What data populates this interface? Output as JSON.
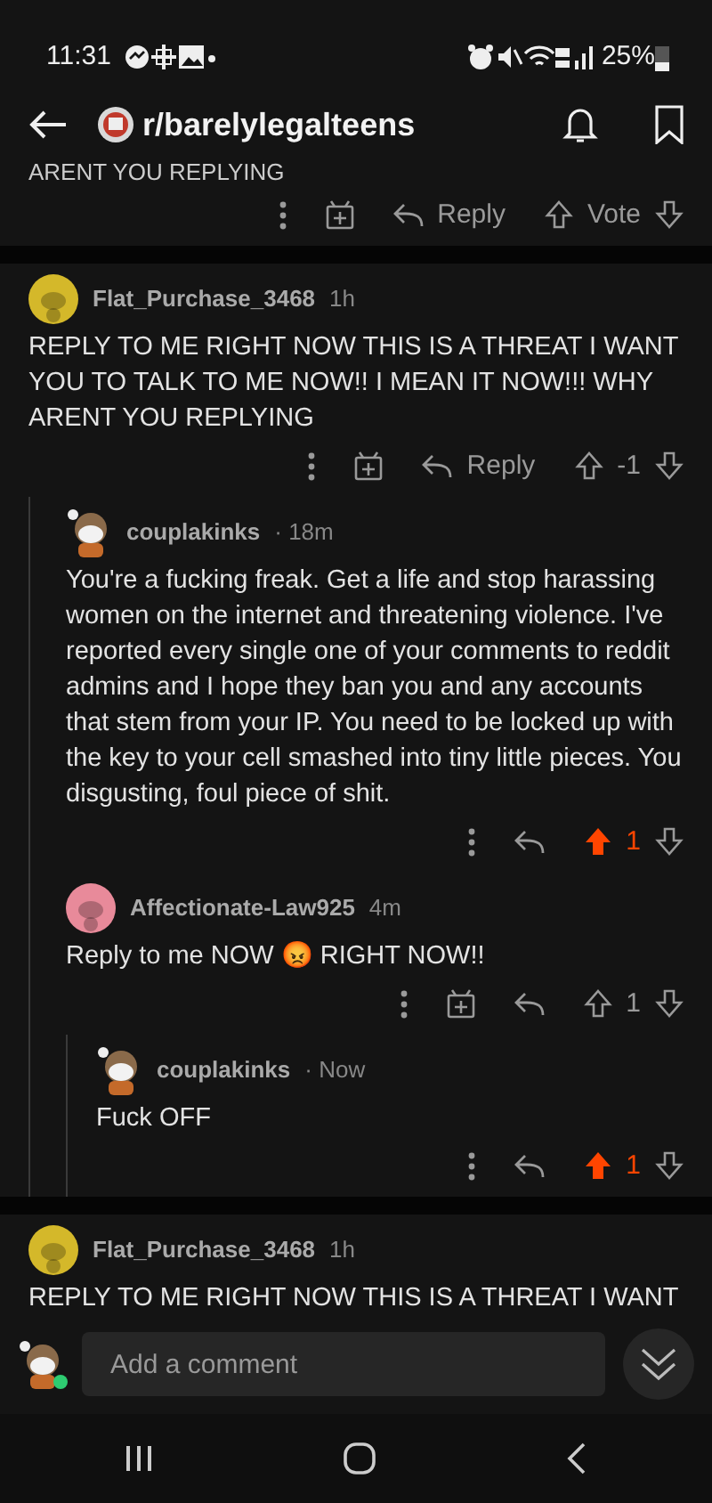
{
  "status_bar": {
    "time": "11:31",
    "battery": "25%"
  },
  "header": {
    "subreddit": "r/barelylegalteens"
  },
  "previous_comment": {
    "body_tail": "ARENT YOU REPLYING",
    "actions": {
      "gift": true,
      "reply_label": "Reply",
      "score": "Vote",
      "upvoted": false
    }
  },
  "comments": [
    {
      "author": "Flat_Purchase_3468",
      "time": "1h",
      "avatar": {
        "kind": "snoo",
        "color": "#d4b82a"
      },
      "body": "REPLY TO ME RIGHT NOW THIS IS A THREAT I WANT YOU TO TALK TO ME NOW!! I MEAN IT NOW!!! WHY ARENT YOU REPLYING",
      "actions": {
        "gift": true,
        "reply_label": "Reply",
        "score": "-1",
        "upvoted": false
      },
      "children": [
        {
          "author": "couplakinks",
          "time": "· 18m",
          "avatar": {
            "kind": "custom"
          },
          "body": "You're a fucking freak. Get a life and stop harassing women on the internet and threatening violence. I've reported every single one of your comments to reddit admins and I hope they ban you and any accounts that stem from your IP. You need to be locked up with the key to your cell smashed into tiny little pieces. You disgusting, foul piece of shit.",
          "actions": {
            "gift": false,
            "score": "1",
            "upvoted": true
          }
        },
        {
          "author": "Affectionate-Law925",
          "time": "4m",
          "avatar": {
            "kind": "snoo",
            "color": "#e88a9a"
          },
          "body": "Reply to me NOW 😡 RIGHT NOW!!",
          "actions": {
            "gift": true,
            "score": "1",
            "upvoted": false
          },
          "children": [
            {
              "author": "couplakinks",
              "time": "· Now",
              "avatar": {
                "kind": "custom"
              },
              "body": "Fuck OFF",
              "actions": {
                "gift": false,
                "score": "1",
                "upvoted": true
              }
            }
          ]
        }
      ]
    },
    {
      "author": "Flat_Purchase_3468",
      "time": "1h",
      "avatar": {
        "kind": "snoo",
        "color": "#d4b82a"
      },
      "body": "REPLY TO ME RIGHT NOW THIS IS A THREAT I WANT"
    }
  ],
  "composer": {
    "placeholder": "Add a comment",
    "online": true
  }
}
